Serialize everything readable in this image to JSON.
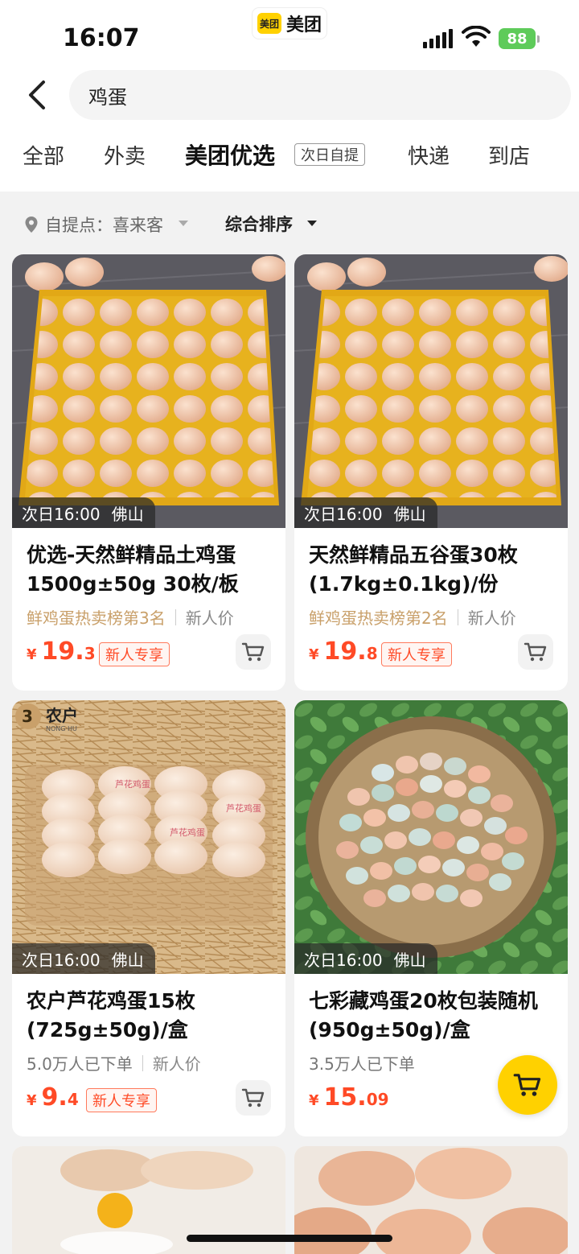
{
  "status": {
    "time": "16:07",
    "battery": "88"
  },
  "app": {
    "logo_text": "美团",
    "name": "美团"
  },
  "search": {
    "query": "鸡蛋"
  },
  "tabs": [
    {
      "label": "全部"
    },
    {
      "label": "外卖"
    },
    {
      "label": "美团优选",
      "badge": "次日自提",
      "active": true
    },
    {
      "label": "快递"
    },
    {
      "label": "到店"
    }
  ],
  "filters": {
    "pickup_label": "自提点：",
    "pickup_value": "喜来客",
    "sort_label": "综合排序"
  },
  "products": [
    {
      "time": "次日16:00",
      "city": "佛山",
      "title": "优选-天然鲜精品土鸡蛋1500g±50g 30枚/板",
      "meta_primary": "鲜鸡蛋热卖榜第3名",
      "meta_secondary": "新人价",
      "currency": "¥",
      "price_int": "19.",
      "price_dec": "3",
      "badge": "新人专享"
    },
    {
      "time": "次日16:00",
      "city": "佛山",
      "title": "天然鲜精品五谷蛋30枚(1.7kg±0.1kg)/份",
      "meta_primary": "鲜鸡蛋热卖榜第2名",
      "meta_secondary": "新人价",
      "currency": "¥",
      "price_int": "19.",
      "price_dec": "8",
      "badge": "新人专享"
    },
    {
      "time": "次日16:00",
      "city": "佛山",
      "title": "农户芦花鸡蛋15枚(725g±50g)/盒",
      "meta_primary": "5.0万人已下单",
      "meta_secondary": "新人价",
      "currency": "¥",
      "price_int": "9.",
      "price_dec": "4",
      "badge": "新人专享",
      "brand": "农户",
      "brand_sub": "NONG·HU",
      "egg_stamp": "芦花鸡蛋"
    },
    {
      "time": "次日16:00",
      "city": "佛山",
      "title": "七彩藏鸡蛋20枚包装随机 (950g±50g)/盒",
      "meta_primary": "3.5万人已下单",
      "currency": "¥",
      "price_int": "15.",
      "price_dec": "09"
    }
  ],
  "colors": {
    "accent": "#ffd100",
    "price": "#ff4a26",
    "rank": "#c9a06a"
  }
}
